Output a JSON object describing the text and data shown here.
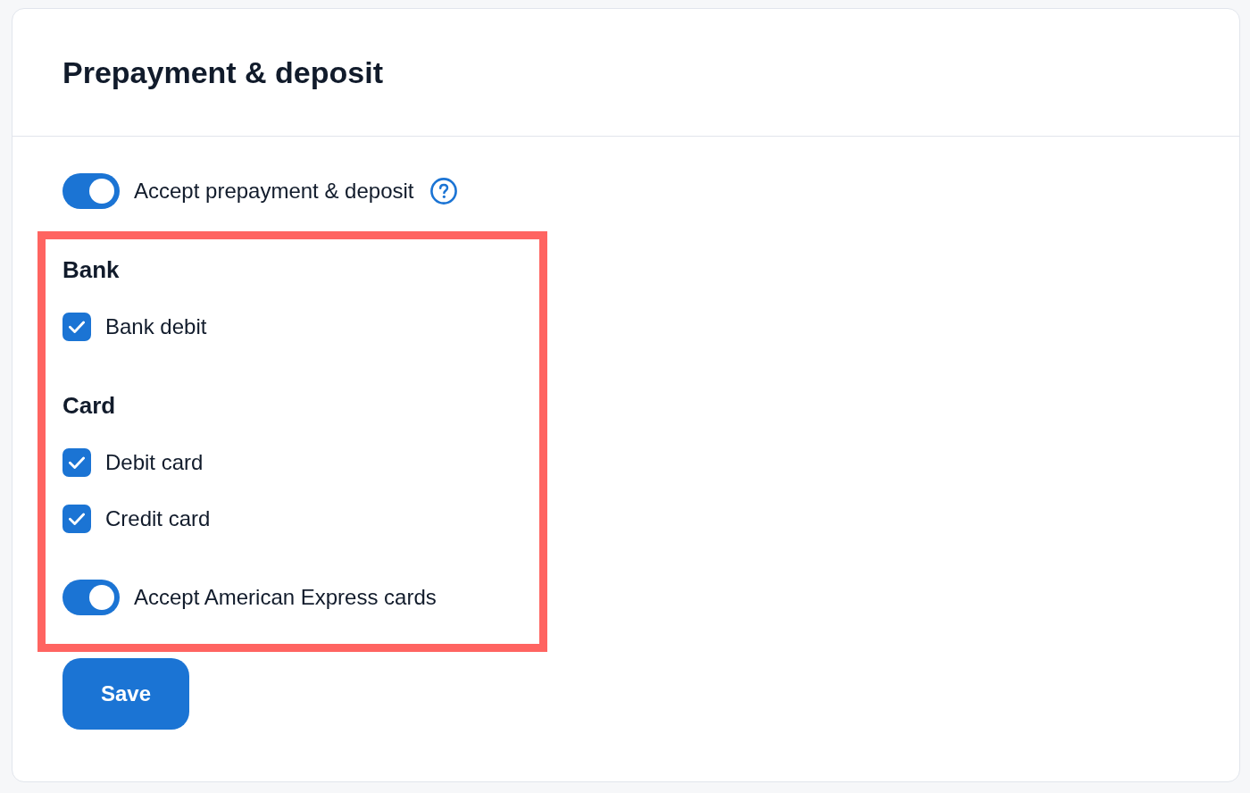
{
  "card": {
    "title": "Prepayment & deposit"
  },
  "main_toggle": {
    "label": "Accept prepayment & deposit",
    "on": true
  },
  "payment_methods": {
    "highlighted": true,
    "groups": [
      {
        "heading": "Bank",
        "options": [
          {
            "kind": "checkbox",
            "label": "Bank debit",
            "checked": true
          }
        ]
      },
      {
        "heading": "Card",
        "options": [
          {
            "kind": "checkbox",
            "label": "Debit card",
            "checked": true
          },
          {
            "kind": "checkbox",
            "label": "Credit card",
            "checked": true
          },
          {
            "kind": "toggle",
            "label": "Accept American Express cards",
            "on": true
          }
        ]
      }
    ]
  },
  "buttons": [
    {
      "label": "Save"
    }
  ]
}
